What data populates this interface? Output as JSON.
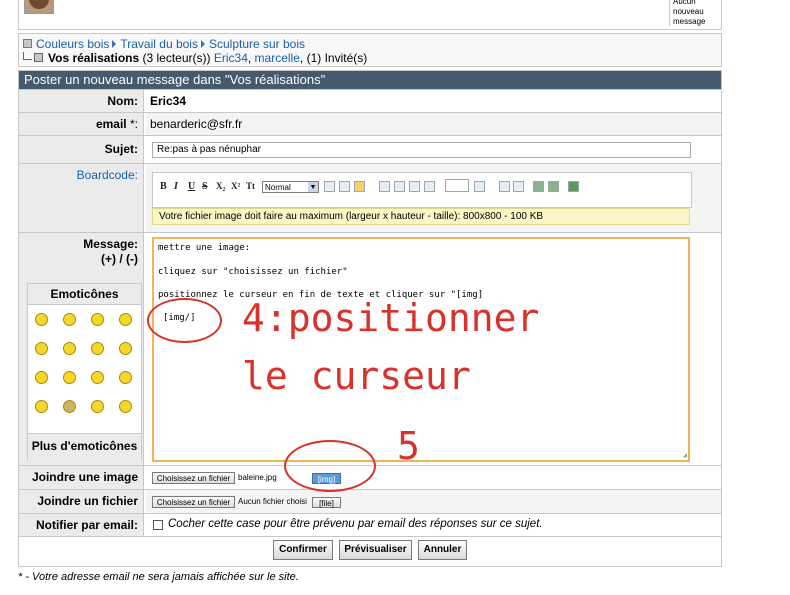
{
  "top": {
    "pm_text": "Aucun nouveau message"
  },
  "breadcrumb": {
    "items": [
      "Couleurs bois",
      "Travail du bois",
      "Sculpture sur bois"
    ],
    "forum_name": "Vos réalisations",
    "readers": "(3 lecteur(s))",
    "users": [
      "Eric34",
      "marcelle"
    ],
    "guests": "(1) Invité(s)"
  },
  "form": {
    "title": "Poster un nouveau message dans \"Vos réalisations\"",
    "name_label": "Nom:",
    "name_value": "Eric34",
    "email_label": "email",
    "email_required": "*:",
    "email_value": "benarderic@sfr.fr",
    "subject_label": "Sujet:",
    "subject_value": "Re:pas à pas nénuphar",
    "boardcode_label": "Boardcode:",
    "font_size_select": "Normal",
    "image_notice": "Votre fichier image doit faire au maximum (largeur x hauteur - taille): 800x800 - 100 KB",
    "message_label": "Message:",
    "message_expand": "(+) / (-)",
    "message_lines": [
      "mettre une image:",
      "cliquez sur \"choisissez un fichier\"",
      "positionnez le curseur en fin de texte et cliquer sur \"[img]",
      "[img/]"
    ],
    "emoticons_title": "Emoticônes",
    "more_emoticons": "Plus d'emoticônes",
    "attach_image_label": "Joindre une image",
    "choose_file": "Choisissez un fichier",
    "image_file_name": "baleine.jpg",
    "img_button": "[img]",
    "attach_file_label": "Joindre un fichier",
    "no_file": "Aucun fichier choisi",
    "file_button": "[file]",
    "notify_label": "Notifier par email:",
    "notify_text": "Cocher cette case pour être prévenu par email des réponses sur ce sujet.",
    "confirm": "Confirmer",
    "preview": "Prévisualiser",
    "cancel": "Annuler"
  },
  "footnote": "* - Votre adresse email ne sera jamais affichée sur le site.",
  "annotations": {
    "step4_line1": "4:positionner",
    "step4_line2": "le curseur",
    "step5": "5"
  },
  "colors": {
    "title_bar": "#455a6c",
    "annotation": "#d9312b",
    "textarea_focus": "#f0b55a",
    "notice_bg": "#fbf6c5"
  }
}
